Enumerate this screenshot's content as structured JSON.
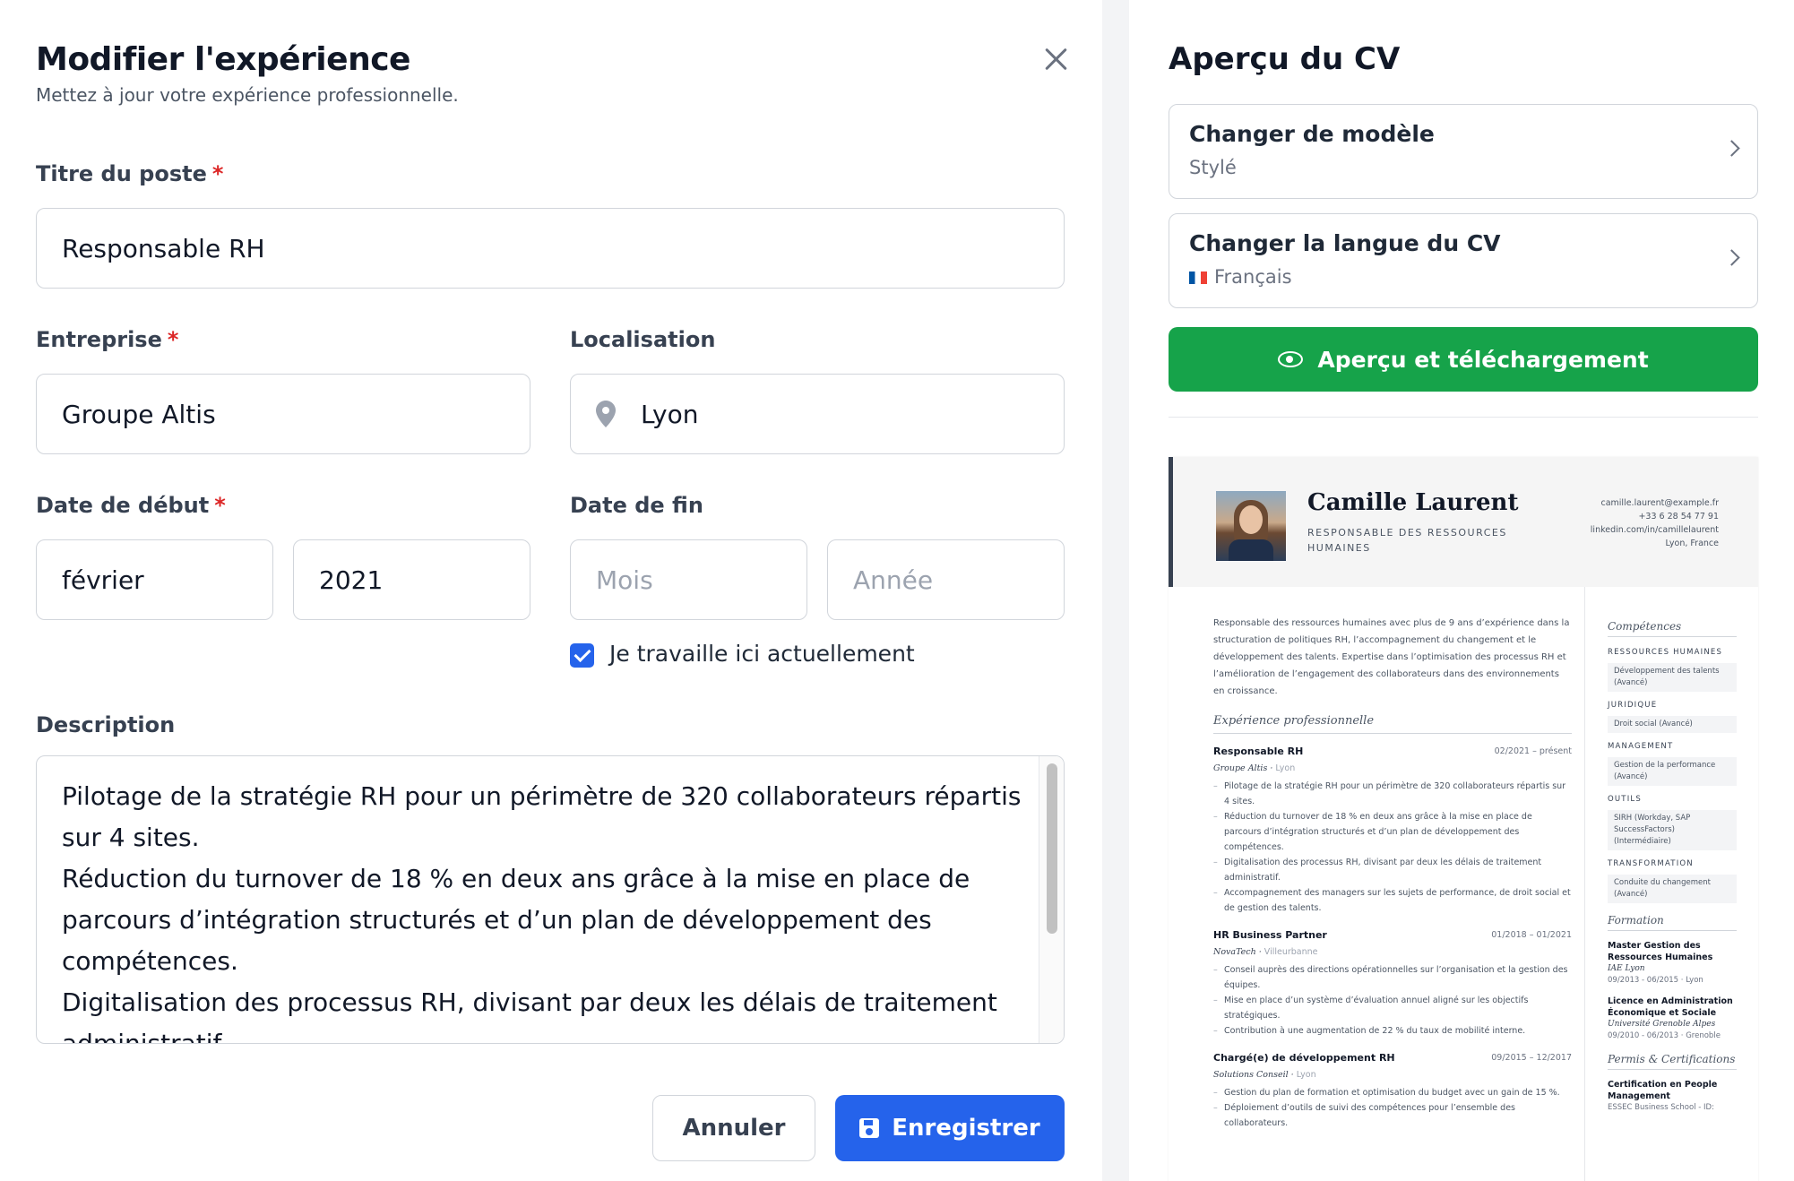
{
  "editor": {
    "title": "Modifier l'expérience",
    "subtitle": "Mettez à jour votre expérience professionnelle.",
    "job_title_label": "Titre du poste",
    "job_title_value": "Responsable RH",
    "company_label": "Entreprise",
    "company_value": "Groupe Altis",
    "location_label": "Localisation",
    "location_value": "Lyon",
    "start_label": "Date de début",
    "start_month": "février",
    "start_year": "2021",
    "end_label": "Date de fin",
    "end_month_placeholder": "Mois",
    "end_year_placeholder": "Année",
    "current_label": "Je travaille ici actuellement",
    "current_checked": true,
    "description_label": "Description",
    "description_value": "Pilotage de la stratégie RH pour un périmètre de 320 collaborateurs répartis sur 4 sites.\nRéduction du turnover de 18 % en deux ans grâce à la mise en place de parcours d’intégration structurés et d’un plan de développement des compétences.\nDigitalisation des processus RH, divisant par deux les délais de traitement administratif.",
    "cancel_label": "Annuler",
    "save_label": "Enregistrer",
    "required_mark": "*"
  },
  "preview_panel": {
    "title": "Aperçu du CV",
    "template_card_title": "Changer de modèle",
    "template_card_value": "Stylé",
    "language_card_title": "Changer la langue du CV",
    "language_card_value": "Français",
    "preview_button": "Aperçu et téléchargement",
    "preview_color": "#16a34a"
  },
  "cv": {
    "name": "Camille Laurent",
    "role": "RESPONSABLE DES RESSOURCES HUMAINES",
    "email": "camille.laurent@example.fr",
    "phone": "+33 6 28 54 77 91",
    "linkedin": "linkedin.com/in/camillelaurent",
    "location": "Lyon, France",
    "summary": "Responsable des ressources humaines avec plus de 9 ans d’expérience dans la structuration de politiques RH, l’accompagnement du changement et le développement des talents. Expertise dans l’optimisation des processus RH et l’amélioration de l’engagement des collaborateurs dans des environnements en croissance.",
    "experience_heading": "Expérience professionnelle",
    "jobs": [
      {
        "title": "Responsable RH",
        "dates": "02/2021 – présent",
        "company": "Groupe Altis",
        "city": "Lyon",
        "bullets": [
          "Pilotage de la stratégie RH pour un périmètre de 320 collaborateurs répartis sur 4 sites.",
          "Réduction du turnover de 18 % en deux ans grâce à la mise en place de parcours d’intégration structurés et d’un plan de développement des compétences.",
          "Digitalisation des processus RH, divisant par deux les délais de traitement administratif.",
          "Accompagnement des managers sur les sujets de performance, de droit social et de gestion des talents."
        ]
      },
      {
        "title": "HR Business Partner",
        "dates": "01/2018 – 01/2021",
        "company": "NovaTech",
        "city": "Villeurbanne",
        "bullets": [
          "Conseil auprès des directions opérationnelles sur l’organisation et la gestion des équipes.",
          "Mise en place d’un système d’évaluation annuel aligné sur les objectifs stratégiques.",
          "Contribution à une augmentation de 22 % du taux de mobilité interne."
        ]
      },
      {
        "title": "Chargé(e) de développement RH",
        "dates": "09/2015 – 12/2017",
        "company": "Solutions Conseil",
        "city": "Lyon",
        "bullets": [
          "Gestion du plan de formation et optimisation du budget avec un gain de 15 %.",
          "Déploiement d’outils de suivi des compétences pour l’ensemble des collaborateurs."
        ]
      }
    ],
    "skills_heading": "Compétences",
    "skill_groups": [
      {
        "category": "RESSOURCES HUMAINES",
        "skills": [
          "Développement des talents (Avancé)"
        ]
      },
      {
        "category": "JURIDIQUE",
        "skills": [
          "Droit social (Avancé)"
        ]
      },
      {
        "category": "MANAGEMENT",
        "skills": [
          "Gestion de la performance (Avancé)"
        ]
      },
      {
        "category": "OUTILS",
        "skills": [
          "SIRH (Workday, SAP SuccessFactors) (Intermédiaire)"
        ]
      },
      {
        "category": "TRANSFORMATION",
        "skills": [
          "Conduite du changement (Avancé)"
        ]
      }
    ],
    "education_heading": "Formation",
    "education": [
      {
        "title": "Master Gestion des Ressources Humaines",
        "school": "IAE Lyon",
        "dates": "09/2013 - 06/2015",
        "city": "Lyon"
      },
      {
        "title": "Licence en Administration Économique et Sociale",
        "school": "Université Grenoble Alpes",
        "dates": "09/2010 - 06/2013",
        "city": "Grenoble"
      }
    ],
    "certs_heading": "Permis & Certifications",
    "certs": [
      {
        "title": "Certification en People Management",
        "school": "ESSEC Business School - ID:"
      }
    ]
  }
}
